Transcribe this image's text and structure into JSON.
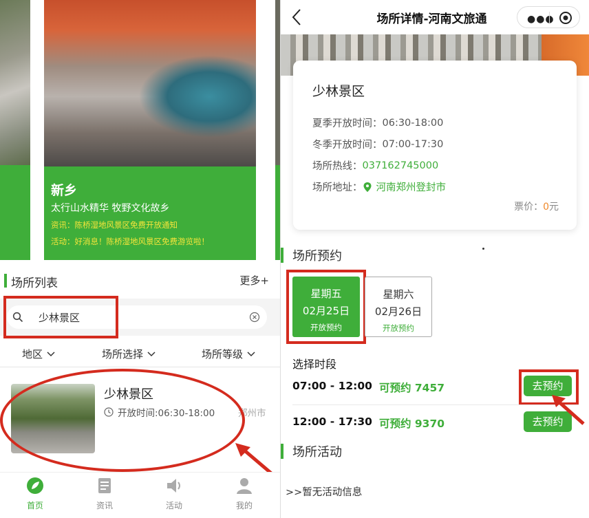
{
  "left": {
    "banner": {
      "city": "新乡",
      "subtitle": "太行山水精华 牧野文化故乡",
      "news": "资讯：陈桥湿地风景区免费开放通知",
      "activity": "活动：好消息！陈桥湿地风景区免费游览啦！"
    },
    "section": {
      "title": "场所列表",
      "more": "更多+"
    },
    "search": {
      "value": "少林景区"
    },
    "filters": [
      {
        "label": "地区"
      },
      {
        "label": "场所选择"
      },
      {
        "label": "场所等级"
      }
    ],
    "card": {
      "title": "少林景区",
      "hours": "开放时间:06:30-18:00",
      "location": "郑州市"
    },
    "tabs": [
      {
        "label": "首页",
        "icon": "home-leaf-icon"
      },
      {
        "label": "资讯",
        "icon": "news-icon"
      },
      {
        "label": "活动",
        "icon": "speaker-icon"
      },
      {
        "label": "我的",
        "icon": "user-icon"
      }
    ]
  },
  "right": {
    "nav": {
      "title": "场所详情-河南文旅通"
    },
    "venue": {
      "name": "少林景区",
      "summer": {
        "label": "夏季开放时间：",
        "value": "06:30-18:00"
      },
      "winter": {
        "label": "冬季开放时间：",
        "value": "07:00-17:30"
      },
      "hotline": {
        "label": "场所热线：",
        "value": "037162745000"
      },
      "address": {
        "label": "场所地址：",
        "value": "河南郑州登封市"
      },
      "price_label": "票价：",
      "price_value": "0",
      "price_unit": "元"
    },
    "booking": {
      "title": "场所预约",
      "days": [
        {
          "week": "星期五",
          "date": "02月25日",
          "status": "开放预约",
          "selected": true
        },
        {
          "week": "星期六",
          "date": "02月26日",
          "status": "开放预约",
          "selected": false
        }
      ],
      "choose_label": "选择时段",
      "slots": [
        {
          "time": "07:00 - 12:00",
          "avail": "可预约 7457",
          "button": "去预约"
        },
        {
          "time": "12:00 - 17:30",
          "avail": "可预约 9370",
          "button": "去预约"
        }
      ]
    },
    "activity": {
      "title": "场所活动",
      "empty": ">>暂无活动信息"
    }
  },
  "colors": {
    "accent": "#3fae3a",
    "highlight": "#d42b1e",
    "price": "#f08a2c",
    "banner_text": "#f4e53a"
  }
}
